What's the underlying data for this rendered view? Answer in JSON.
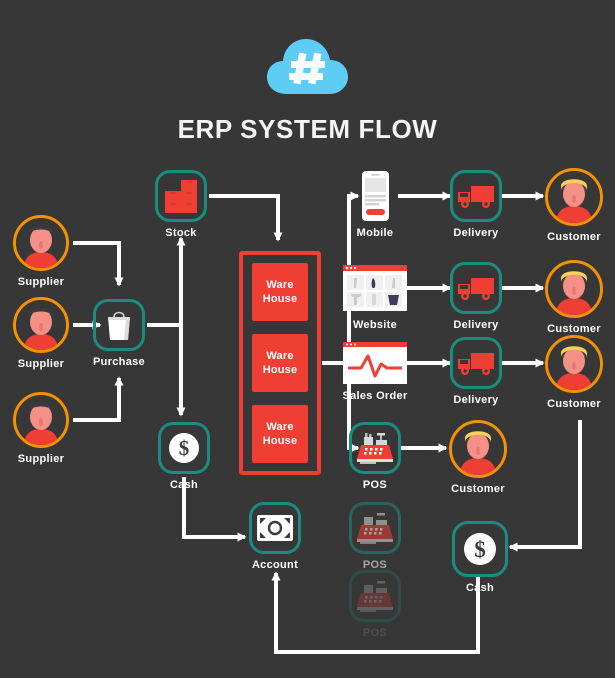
{
  "page": {
    "title": "ERP SYSTEM FLOW",
    "logo_icon": "cloud-hash-icon",
    "background": "#373737",
    "accent_teal": "#1a8c80",
    "accent_orange": "#f59100",
    "accent_red": "#ef3e33",
    "wire_color": "#ffffff"
  },
  "nodes": {
    "suppliers": [
      {
        "label": "Supplier",
        "icon": "person-avatar-icon"
      },
      {
        "label": "Supplier",
        "icon": "person-avatar-icon"
      },
      {
        "label": "Supplier",
        "icon": "person-avatar-icon"
      }
    ],
    "purchase": {
      "label": "Purchase",
      "icon": "shopping-bag-icon"
    },
    "stock": {
      "label": "Stock",
      "icon": "stacked-boxes-icon"
    },
    "cash_left": {
      "label": "Cash",
      "icon": "dollar-coin-icon"
    },
    "account": {
      "label": "Account",
      "icon": "banknote-icon"
    },
    "warehouses": [
      {
        "line1": "Ware",
        "line2": "House"
      },
      {
        "line1": "Ware",
        "line2": "House"
      },
      {
        "line1": "Ware",
        "line2": "House"
      }
    ],
    "channels": [
      {
        "label": "Mobile",
        "icon": "smartphone-icon"
      },
      {
        "label": "Website",
        "icon": "browser-window-icon"
      },
      {
        "label": "Sales Order",
        "icon": "line-chart-window-icon"
      }
    ],
    "pos_main": {
      "label": "POS",
      "icon": "cash-register-icon"
    },
    "pos_faded": [
      {
        "label": "POS",
        "icon": "cash-register-icon"
      },
      {
        "label": "POS",
        "icon": "cash-register-icon"
      }
    ],
    "deliveries": [
      {
        "label": "Delivery",
        "icon": "delivery-truck-icon"
      },
      {
        "label": "Delivery",
        "icon": "delivery-truck-icon"
      },
      {
        "label": "Delivery",
        "icon": "delivery-truck-icon"
      }
    ],
    "customers": [
      {
        "label": "Customer",
        "icon": "person-avatar-icon"
      },
      {
        "label": "Customer",
        "icon": "person-avatar-icon"
      },
      {
        "label": "Customer",
        "icon": "person-avatar-icon"
      },
      {
        "label": "Customer",
        "icon": "person-avatar-icon"
      }
    ],
    "cash_right": {
      "label": "Cash",
      "icon": "dollar-coin-icon"
    }
  }
}
